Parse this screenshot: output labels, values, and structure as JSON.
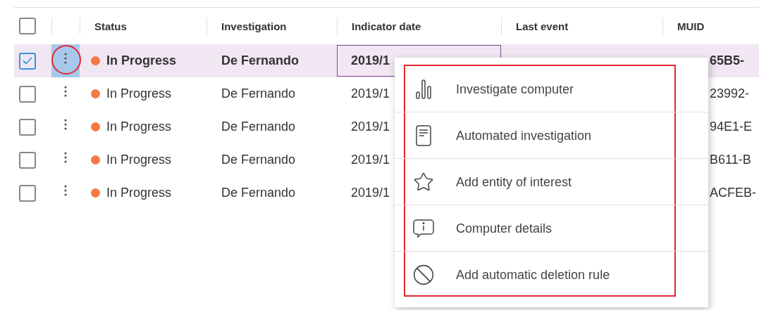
{
  "table": {
    "header_checkbox": {
      "checked": false
    },
    "columns": [
      {
        "label": "Status"
      },
      {
        "label": "Investigation"
      },
      {
        "label": "Indicator date"
      },
      {
        "label": "Last event"
      },
      {
        "label": "MUID"
      }
    ],
    "rows": [
      {
        "checked": true,
        "selected": true,
        "menu_open": true,
        "status": "In Progress",
        "investigation": "De Fernando",
        "indicator_date": "2019/1",
        "muid": "65B5-"
      },
      {
        "checked": false,
        "selected": false,
        "menu_open": false,
        "status": "In Progress",
        "investigation": "De Fernando",
        "indicator_date": "2019/1",
        "muid": "23992-"
      },
      {
        "checked": false,
        "selected": false,
        "menu_open": false,
        "status": "In Progress",
        "investigation": "De Fernando",
        "indicator_date": "2019/1",
        "muid": "94E1-E"
      },
      {
        "checked": false,
        "selected": false,
        "menu_open": false,
        "status": "In Progress",
        "investigation": "De Fernando",
        "indicator_date": "2019/1",
        "muid": "B611-B"
      },
      {
        "checked": false,
        "selected": false,
        "menu_open": false,
        "status": "In Progress",
        "investigation": "De Fernando",
        "indicator_date": "2019/1",
        "muid": "ACFEB-"
      }
    ]
  },
  "context_menu": {
    "items": [
      {
        "kind": "investigate",
        "label": "Investigate computer"
      },
      {
        "kind": "automated",
        "label": "Automated investigation"
      },
      {
        "kind": "entity",
        "label": "Add entity of interest"
      },
      {
        "kind": "details",
        "label": "Computer details"
      },
      {
        "kind": "deletion",
        "label": "Add automatic deletion rule"
      }
    ]
  }
}
